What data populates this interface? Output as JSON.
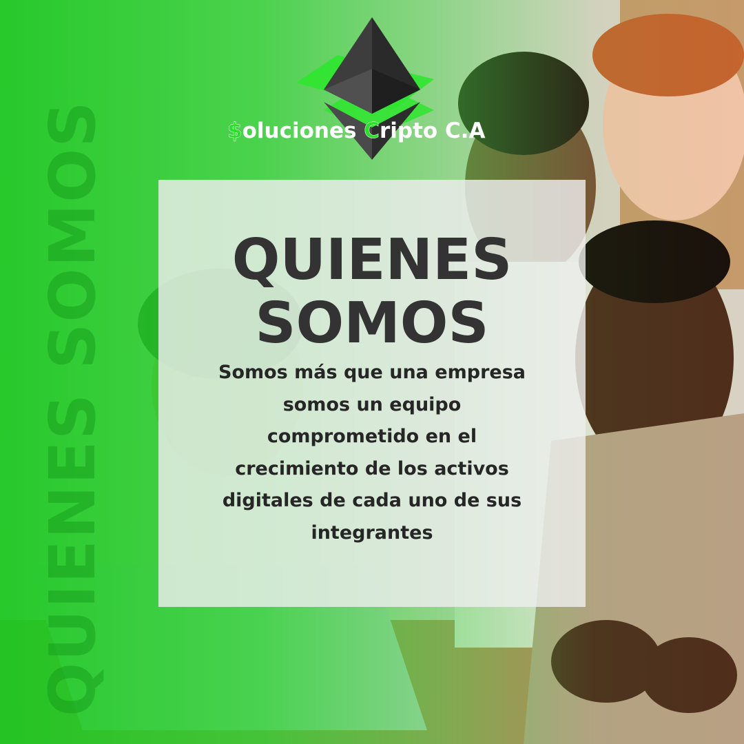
{
  "brand": {
    "name_prefix_letter": "$",
    "name_part1": "oluciones ",
    "name_accent_letter": "C",
    "name_part2": "ripto C.A",
    "logo_icon": "ethereum-diamond-icon",
    "accent_color": "#27e027"
  },
  "side_label": "QUIENES SOMOS",
  "headline": {
    "line1": "QUIENES",
    "line2": "SOMOS"
  },
  "body": {
    "text": "Somos más que una empresa somos un equipo comprometido en el crecimiento de los activos digitales de cada uno de sus integrantes"
  },
  "colors": {
    "green": "#19c81f",
    "panel": "#eeeeee",
    "headline": "#333333"
  }
}
